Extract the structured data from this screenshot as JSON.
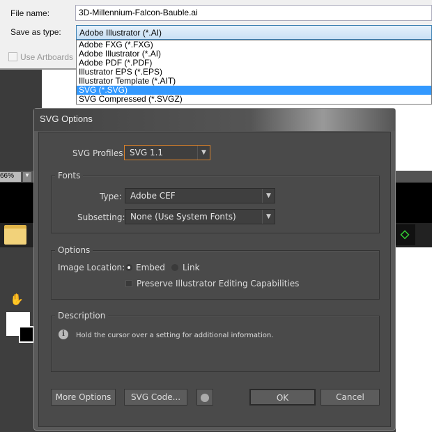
{
  "save_dialog": {
    "file_name_label": "File name:",
    "file_name_value": "3D-Millennium-Falcon-Bauble.ai",
    "save_as_type_label": "Save as type:",
    "save_as_type_value": "Adobe Illustrator (*.AI)",
    "use_artboards_label": "Use Artboards",
    "type_options": [
      "Adobe FXG (*.FXG)",
      "Adobe Illustrator (*.AI)",
      "Adobe PDF (*.PDF)",
      "Illustrator EPS (*.EPS)",
      "Illustrator Template (*.AIT)",
      "SVG (*.SVG)",
      "SVG Compressed (*.SVGZ)"
    ],
    "highlighted_option": "SVG (*.SVG)"
  },
  "background": {
    "zoom_value": "66%"
  },
  "svg_options": {
    "title": "SVG Options",
    "profiles_label": "SVG Profiles:",
    "profiles_value": "SVG 1.1",
    "fonts_group": "Fonts",
    "type_label": "Type:",
    "type_value": "Adobe CEF",
    "subsetting_label": "Subsetting:",
    "subsetting_value": "None (Use System Fonts)",
    "options_group": "Options",
    "image_location_label": "Image Location:",
    "embed_label": "Embed",
    "link_label": "Link",
    "image_location_selected": "Embed",
    "preserve_label": "Preserve Illustrator Editing Capabilities",
    "preserve_checked": false,
    "description_group": "Description",
    "description_text": "Hold the cursor over a setting for additional information.",
    "more_options": "More Options",
    "svg_code": "SVG Code...",
    "ok": "OK",
    "cancel": "Cancel",
    "accent_color": "#d9822b"
  }
}
